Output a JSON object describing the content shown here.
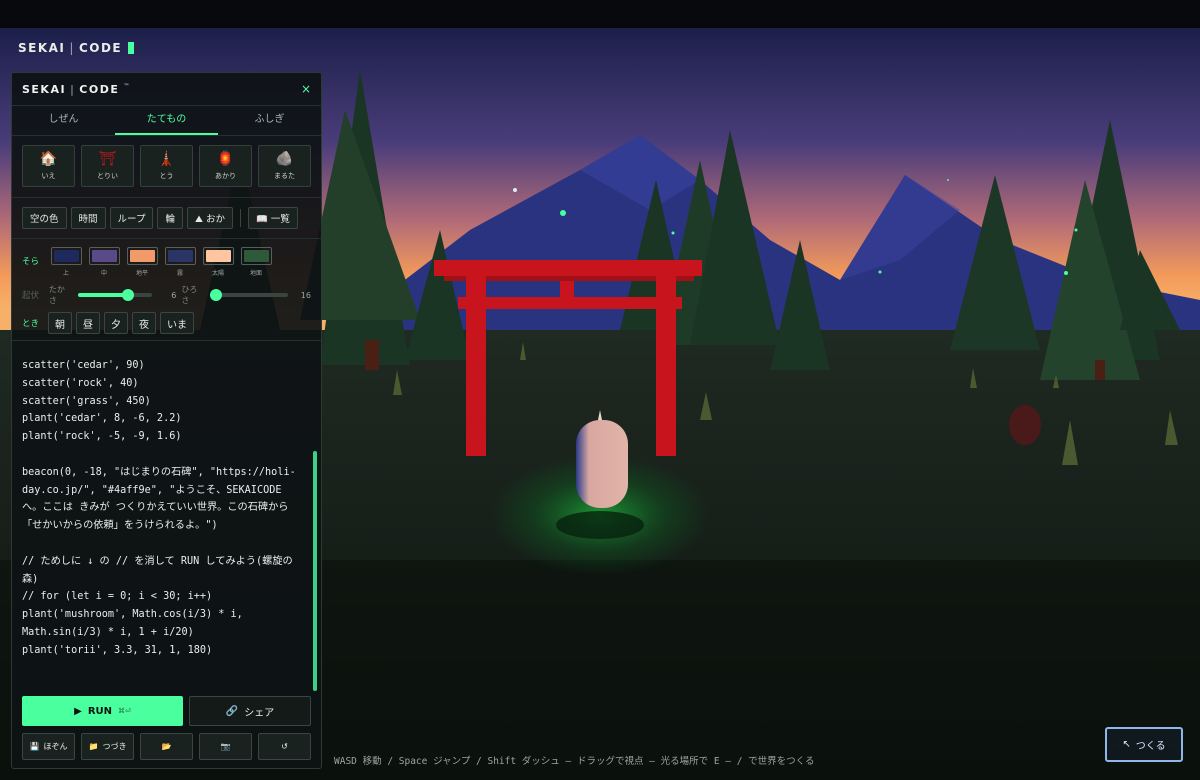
{
  "brand": {
    "left": "SEKAI",
    "right": "CODE",
    "tm": "™"
  },
  "panel": {
    "close_icon": "close-icon",
    "close_glyph": "×"
  },
  "tabs": [
    {
      "label": "しぜん",
      "active": false
    },
    {
      "label": "たてもの",
      "active": true
    },
    {
      "label": "ふしぎ",
      "active": false
    }
  ],
  "build_items": [
    {
      "icon": "house-icon",
      "glyph": "🏠",
      "label": "いえ"
    },
    {
      "icon": "torii-icon",
      "glyph": "⛩",
      "label": "とりい"
    },
    {
      "icon": "tower-icon",
      "glyph": "🗼",
      "label": "とう"
    },
    {
      "icon": "lantern-icon",
      "glyph": "🏮",
      "label": "あかり"
    },
    {
      "icon": "boulder-icon",
      "glyph": "🪨",
      "label": "まるた"
    }
  ],
  "snippets": [
    "空の色",
    "時間",
    "ループ",
    "輪",
    "⛰ おか"
  ],
  "list_button": "📖 一覧",
  "sky": {
    "label": "そら",
    "swatches": [
      {
        "label": "上",
        "color": "#1e2a5e"
      },
      {
        "label": "中",
        "color": "#5a4a8a"
      },
      {
        "label": "地平",
        "color": "#f39a6a"
      },
      {
        "label": "霧",
        "color": "#2a3566"
      },
      {
        "label": "太陽",
        "color": "#ffc4a0"
      },
      {
        "label": "地面",
        "color": "#2e5a3a"
      }
    ]
  },
  "terrain": {
    "label": "起伏",
    "height_label": "たかさ",
    "height_value": 6,
    "height_fraction": 0.66,
    "width_label": "ひろさ",
    "width_value": 16,
    "width_fraction": 0.08
  },
  "time": {
    "label": "とき",
    "buttons": [
      "朝",
      "昼",
      "夕",
      "夜",
      "いま"
    ]
  },
  "code": "scatter('cedar', 90)\nscatter('rock', 40)\nscatter('grass', 450)\nplant('cedar', 8, -6, 2.2)\nplant('rock', -5, -9, 1.6)\n\nbeacon(0, -18, \"はじまりの石碑\", \"https://holi-\nday.co.jp/\", \"#4aff9e\", \"ようこそ、SEKAICODE\nへ。ここは きみが つくりかえていい世界。この石碑から\n「せかいからの依頼」をうけられるよ。\")\n\n// ためしに ↓ の // を消して RUN してみよう(螺旋の\n森)\n// for (let i = 0; i < 30; i++)\nplant('mushroom', Math.cos(i/3) * i,\nMath.sin(i/3) * i, 1 + i/20)\nplant('torii', 3.3, 31, 1, 180)",
  "run": {
    "label": "RUN",
    "glyph": "▶",
    "shortcut": "⌘⏎"
  },
  "share": {
    "label": "シェア",
    "glyph": "🔗"
  },
  "utils": [
    {
      "icon": "save-icon",
      "glyph": "💾",
      "label": "ほぞん"
    },
    {
      "icon": "folder-icon",
      "glyph": "📁",
      "label": "つづき"
    },
    {
      "icon": "open-folder-icon",
      "glyph": "📂",
      "label": ""
    },
    {
      "icon": "screenshot-icon",
      "glyph": "📷",
      "label": ""
    },
    {
      "icon": "reset-icon",
      "glyph": "↺",
      "label": ""
    }
  ],
  "hint": "WASD 移動 / Space ジャンプ / Shift ダッシュ — ドラッグで視点 — 光る場所で E — / で世界をつくる",
  "make_button": {
    "label": "つくる",
    "glyph": "↖"
  },
  "colors": {
    "accent": "#4aff9e",
    "torii": "#c8141c"
  }
}
